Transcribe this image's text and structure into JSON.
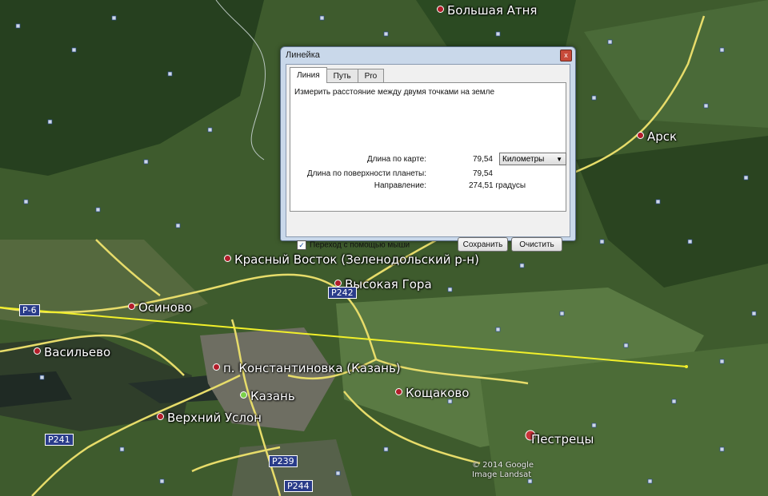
{
  "map": {
    "places": [
      {
        "name": "Большая Атня",
        "id": "bolshaya-atnya"
      },
      {
        "name": "Арск",
        "id": "arsk"
      },
      {
        "name": "Красный Восток (Зеленодольский р-н)",
        "id": "krasny-vostok"
      },
      {
        "name": "Высокая Гора",
        "id": "vysokaya-gora"
      },
      {
        "name": "Осиново",
        "id": "osinovo"
      },
      {
        "name": "Васильево",
        "id": "vasilyevo"
      },
      {
        "name": "п. Константиновка (Казань)",
        "id": "konstantinovka"
      },
      {
        "name": "Казань",
        "id": "kazan"
      },
      {
        "name": "Кощаково",
        "id": "koshchakovo"
      },
      {
        "name": "Верхний Услон",
        "id": "verkhny-uslon"
      },
      {
        "name": "Пестрецы",
        "id": "pestretsy"
      }
    ],
    "road_signs": [
      "Р242",
      "Р241",
      "Р239",
      "Р244",
      "Р-6"
    ],
    "copyright": "© 2014 Google",
    "imagery": "Image Landsat"
  },
  "dialog": {
    "title": "Линейка",
    "close_glyph": "x",
    "tabs": [
      {
        "label": "Линия",
        "active": true
      },
      {
        "label": "Путь",
        "active": false
      },
      {
        "label": "Pro",
        "active": false
      }
    ],
    "description": "Измерить расстояние между двумя точками на земле",
    "map_length_label": "Длина по карте:",
    "map_length_value": "79,54",
    "units_selected": "Километры",
    "ground_length_label": "Длина по поверхности планеты:",
    "ground_length_value": "79,54",
    "heading_label": "Направление:",
    "heading_value": "274,51 градусы",
    "mouse_nav_label": "Переход с помощью мыши",
    "mouse_nav_checked": true,
    "save_label": "Сохранить",
    "clear_label": "Очистить"
  }
}
